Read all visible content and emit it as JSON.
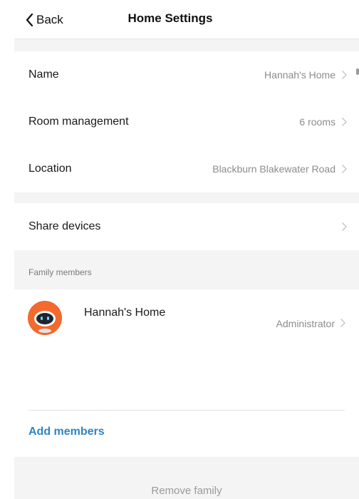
{
  "nav": {
    "back_label": "Back",
    "title": "Home Settings"
  },
  "settings": {
    "name": {
      "label": "Name",
      "value": "Hannah's Home"
    },
    "rooms": {
      "label": "Room management",
      "value": "6 rooms"
    },
    "location": {
      "label": "Location",
      "value": "Blackburn Blakewater Road"
    },
    "share": {
      "label": "Share devices"
    }
  },
  "family": {
    "caption": "Family members",
    "members": [
      {
        "name": "Hannah's Home",
        "role": "Administrator",
        "avatar": "robot-avatar-icon"
      }
    ],
    "add_label": "Add members"
  },
  "footer": {
    "remove_label": "Remove family"
  },
  "colors": {
    "accent": "#2d86c6",
    "avatar_bg": "#f26a2e",
    "background": "#f4f4f4"
  }
}
